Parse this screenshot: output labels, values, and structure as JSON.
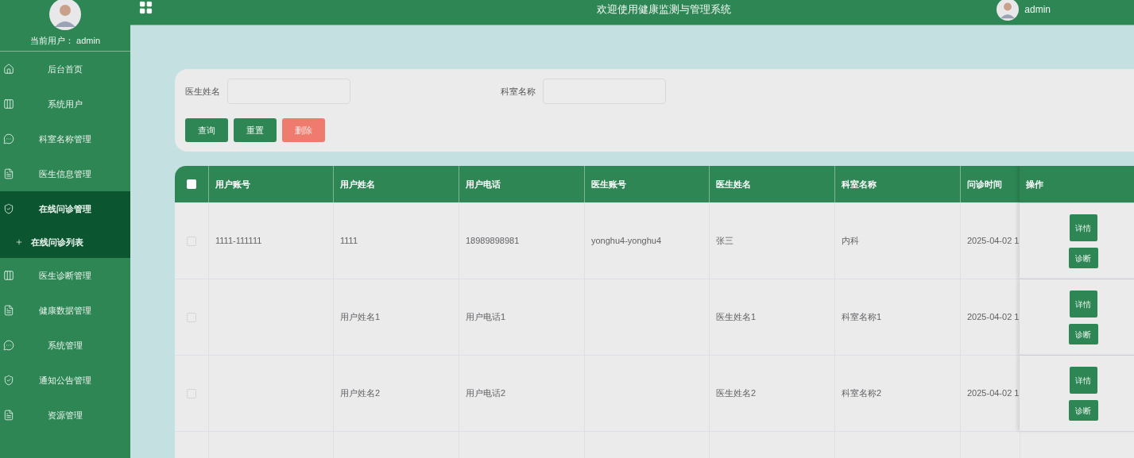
{
  "sidebar": {
    "current_user_label": "当前用户：",
    "current_user": "admin",
    "items": [
      {
        "label": "后台首页",
        "kind": "home",
        "selected": false
      },
      {
        "label": "系统用户",
        "kind": "columns",
        "selected": false
      },
      {
        "label": "科室名称管理",
        "kind": "chat",
        "selected": false
      },
      {
        "label": "医生信息管理",
        "kind": "document",
        "selected": false
      },
      {
        "label": "在线问诊管理",
        "kind": "shield",
        "selected": true,
        "children": [
          {
            "label": "在线问诊列表"
          }
        ]
      },
      {
        "label": "医生诊断管理",
        "kind": "columns",
        "selected": false
      },
      {
        "label": "健康数据管理",
        "kind": "document",
        "selected": false
      },
      {
        "label": "系统管理",
        "kind": "chat",
        "selected": false
      },
      {
        "label": "通知公告管理",
        "kind": "shield",
        "selected": false
      },
      {
        "label": "资源管理",
        "kind": "document",
        "selected": false
      }
    ]
  },
  "header": {
    "title": "欢迎使用健康监测与管理系统",
    "user": "admin"
  },
  "search": {
    "fields": [
      {
        "label": "医生姓名"
      },
      {
        "label": "科室名称"
      }
    ],
    "buttons": [
      {
        "label": "查询",
        "kind": "primary"
      },
      {
        "label": "重置",
        "kind": "primary"
      },
      {
        "label": "删除",
        "kind": "danger"
      }
    ]
  },
  "table": {
    "select_all_checked": false,
    "columns": [
      "用户账号",
      "用户姓名",
      "用户电话",
      "医生账号",
      "医生姓名",
      "科室名称",
      "问诊时间"
    ],
    "actions_column": "操作",
    "rows": [
      {
        "checked": false,
        "cells": [
          "1111-111111",
          "1111",
          "18989898981",
          "yonghu4-yonghu4",
          "张三",
          "内科",
          "2025-04-02 1"
        ],
        "actions": [
          "详情",
          "诊断"
        ]
      },
      {
        "checked": false,
        "cells": [
          "",
          "用户姓名1",
          "用户电话1",
          "",
          "医生姓名1",
          "科室名称1",
          "2025-04-02 1"
        ],
        "actions": [
          "详情",
          "诊断"
        ]
      },
      {
        "checked": false,
        "cells": [
          "",
          "用户姓名2",
          "用户电话2",
          "",
          "医生姓名2",
          "科室名称2",
          "2025-04-02 1"
        ],
        "actions": [
          "详情",
          "诊断"
        ]
      }
    ]
  }
}
